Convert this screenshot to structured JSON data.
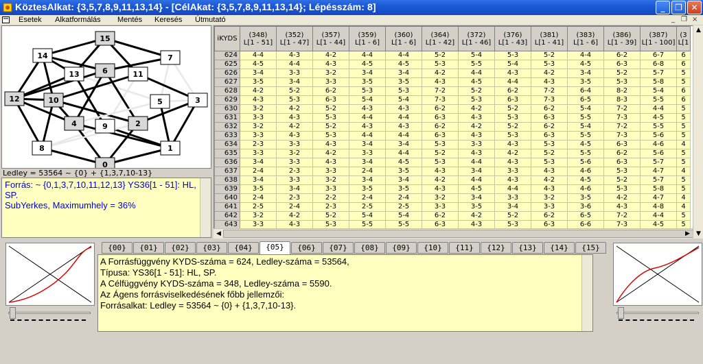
{
  "window": {
    "title": "KöztesAlkat: {3,5,7,8,9,11,13,14} - [CélAkat: {3,5,7,8,9,11,13,14}; Lépésszám: 8]",
    "minimize_label": "_",
    "maximize_label": "❐",
    "close_label": "✕",
    "accent": "#1c58d6"
  },
  "menu": {
    "items": [
      "Esetek",
      "Alkatformálás",
      "Mentés",
      "Keresés",
      "Útmutató"
    ],
    "mdi_controls": [
      "_",
      "❐",
      "×"
    ]
  },
  "graph": {
    "nodes": [
      {
        "id": "0",
        "label": "0",
        "style": "gray"
      },
      {
        "id": "1",
        "label": "1",
        "style": "white"
      },
      {
        "id": "2",
        "label": "2",
        "style": "gray"
      },
      {
        "id": "3",
        "label": "3",
        "style": "white"
      },
      {
        "id": "4",
        "label": "4",
        "style": "gray"
      },
      {
        "id": "5",
        "label": "5",
        "style": "white"
      },
      {
        "id": "6",
        "label": "6",
        "style": "gray"
      },
      {
        "id": "7",
        "label": "7",
        "style": "white"
      },
      {
        "id": "8",
        "label": "8",
        "style": "white"
      },
      {
        "id": "9",
        "label": "9",
        "style": "white"
      },
      {
        "id": "10",
        "label": "10",
        "style": "gray"
      },
      {
        "id": "11",
        "label": "11",
        "style": "white"
      },
      {
        "id": "12",
        "label": "12",
        "style": "gray"
      },
      {
        "id": "13",
        "label": "13",
        "style": "white"
      },
      {
        "id": "14",
        "label": "14",
        "style": "white"
      },
      {
        "id": "15",
        "label": "15",
        "style": "gray"
      }
    ]
  },
  "ledley_label": "Ledley = 53564 ~ {0} + {1,3,7,10-13}",
  "source": {
    "line1": "Forrás: ~ {0,1,3,7,10,11,12,13} YS36[1 - 51]: HL, SP.",
    "line2": "SubYerkes, Maximumhely = 36%"
  },
  "table": {
    "row_header": "iKYDS",
    "columns": [
      {
        "n": "(348)",
        "r": "L[1 - 51]"
      },
      {
        "n": "(352)",
        "r": "L[1 - 47]"
      },
      {
        "n": "(357)",
        "r": "L[1 - 44]"
      },
      {
        "n": "(359)",
        "r": "L[1 - 6]"
      },
      {
        "n": "(360)",
        "r": "L[1 - 6]"
      },
      {
        "n": "(364)",
        "r": "L[1 - 42]"
      },
      {
        "n": "(372)",
        "r": "L[1 - 46]"
      },
      {
        "n": "(376)",
        "r": "L[1 - 43]"
      },
      {
        "n": "(381)",
        "r": "L[1 - 41]"
      },
      {
        "n": "(383)",
        "r": "L[1 - 6]"
      },
      {
        "n": "(386)",
        "r": "L[1 - 39]"
      },
      {
        "n": "(387)",
        "r": "L[1 - 100]"
      },
      {
        "n": "(3",
        "r": "L[1"
      }
    ],
    "rows": [
      [
        "624",
        "4-4",
        "4-3",
        "4-2",
        "4-4",
        "4-4",
        "5-2",
        "5-4",
        "5-3",
        "5-2",
        "4-4",
        "6-2",
        "6-7",
        "6"
      ],
      [
        "625",
        "4-5",
        "4-4",
        "4-3",
        "4-5",
        "4-5",
        "5-3",
        "5-5",
        "5-4",
        "5-3",
        "4-5",
        "6-3",
        "6-8",
        "6"
      ],
      [
        "626",
        "3-4",
        "3-3",
        "3-2",
        "3-4",
        "3-4",
        "4-2",
        "4-4",
        "4-3",
        "4-2",
        "3-4",
        "5-2",
        "5-7",
        "5"
      ],
      [
        "627",
        "3-5",
        "3-4",
        "3-3",
        "3-5",
        "3-5",
        "4-3",
        "4-5",
        "4-4",
        "4-3",
        "3-5",
        "5-3",
        "5-8",
        "5"
      ],
      [
        "628",
        "4-2",
        "5-2",
        "6-2",
        "5-3",
        "5-3",
        "7-2",
        "5-2",
        "6-2",
        "7-2",
        "6-4",
        "8-2",
        "5-4",
        "6"
      ],
      [
        "629",
        "4-3",
        "5-3",
        "6-3",
        "5-4",
        "5-4",
        "7-3",
        "5-3",
        "6-3",
        "7-3",
        "6-5",
        "8-3",
        "5-5",
        "6"
      ],
      [
        "630",
        "3-2",
        "4-2",
        "5-2",
        "4-3",
        "4-3",
        "6-2",
        "4-2",
        "5-2",
        "6-2",
        "5-4",
        "7-2",
        "4-4",
        "5"
      ],
      [
        "631",
        "3-3",
        "4-3",
        "5-3",
        "4-4",
        "4-4",
        "6-3",
        "4-3",
        "5-3",
        "6-3",
        "5-5",
        "7-3",
        "4-5",
        "5"
      ],
      [
        "632",
        "3-2",
        "4-2",
        "5-2",
        "4-3",
        "4-3",
        "6-2",
        "4-2",
        "5-2",
        "6-2",
        "5-4",
        "7-2",
        "5-5",
        "5"
      ],
      [
        "633",
        "3-3",
        "4-3",
        "5-3",
        "4-4",
        "4-4",
        "6-3",
        "4-3",
        "5-3",
        "6-3",
        "5-5",
        "7-3",
        "5-6",
        "5"
      ],
      [
        "634",
        "2-3",
        "3-3",
        "4-3",
        "3-4",
        "3-4",
        "5-3",
        "3-3",
        "4-3",
        "5-3",
        "4-5",
        "6-3",
        "4-6",
        "4"
      ],
      [
        "635",
        "3-3",
        "3-2",
        "4-2",
        "3-3",
        "4-4",
        "5-2",
        "4-3",
        "4-2",
        "5-2",
        "5-5",
        "6-2",
        "5-6",
        "5"
      ],
      [
        "636",
        "3-4",
        "3-3",
        "4-3",
        "3-4",
        "4-5",
        "5-3",
        "4-4",
        "4-3",
        "5-3",
        "5-6",
        "6-3",
        "5-7",
        "5"
      ],
      [
        "637",
        "2-4",
        "2-3",
        "3-3",
        "2-4",
        "3-5",
        "4-3",
        "3-4",
        "3-3",
        "4-3",
        "4-6",
        "5-3",
        "4-7",
        "4"
      ],
      [
        "638",
        "3-4",
        "3-3",
        "3-2",
        "3-4",
        "3-4",
        "4-2",
        "4-4",
        "4-3",
        "4-2",
        "4-5",
        "5-2",
        "5-7",
        "5"
      ],
      [
        "639",
        "3-5",
        "3-4",
        "3-3",
        "3-5",
        "3-5",
        "4-3",
        "4-5",
        "4-4",
        "4-3",
        "4-6",
        "5-3",
        "5-8",
        "5"
      ],
      [
        "640",
        "2-4",
        "2-3",
        "2-2",
        "2-4",
        "2-4",
        "3-2",
        "3-4",
        "3-3",
        "3-2",
        "3-5",
        "4-2",
        "4-7",
        "4"
      ],
      [
        "641",
        "2-5",
        "2-4",
        "2-3",
        "2-5",
        "2-5",
        "3-3",
        "3-5",
        "3-4",
        "3-3",
        "3-6",
        "4-3",
        "4-8",
        "4"
      ],
      [
        "642",
        "3-2",
        "4-2",
        "5-2",
        "5-4",
        "5-4",
        "6-2",
        "4-2",
        "5-2",
        "6-2",
        "6-5",
        "7-2",
        "4-4",
        "5"
      ],
      [
        "643",
        "3-3",
        "4-3",
        "5-3",
        "5-5",
        "5-5",
        "6-3",
        "4-3",
        "5-3",
        "6-3",
        "6-6",
        "7-3",
        "4-5",
        "5"
      ]
    ]
  },
  "tabs": [
    "{00}",
    "{01}",
    "{02}",
    "{03}",
    "{04}",
    "{05}",
    "{06}",
    "{07}",
    "{08}",
    "{09}",
    "{10}",
    "{11}",
    "{12}",
    "{13}",
    "{14}",
    "{15}"
  ],
  "active_tab": 5,
  "report": {
    "lines": [
      "A Forrásfüggvény KYDS-száma = 624, Ledley-száma = 53564,",
      "Típusa: YS36[1 - 51]: HL, SP.",
      "A Célfüggvény KYDS-száma = 348, Ledley-száma = 5590.",
      "Az Ágens forrásviselkedésének főbb jellemzői:",
      "Forrásalkat: Ledley = 53564 ~ {0} + {1,3,7,10-13}."
    ]
  },
  "colors": {
    "yellow_bg": "#ffffc0",
    "source_text": "#0000e0",
    "curve": "#e00000"
  }
}
